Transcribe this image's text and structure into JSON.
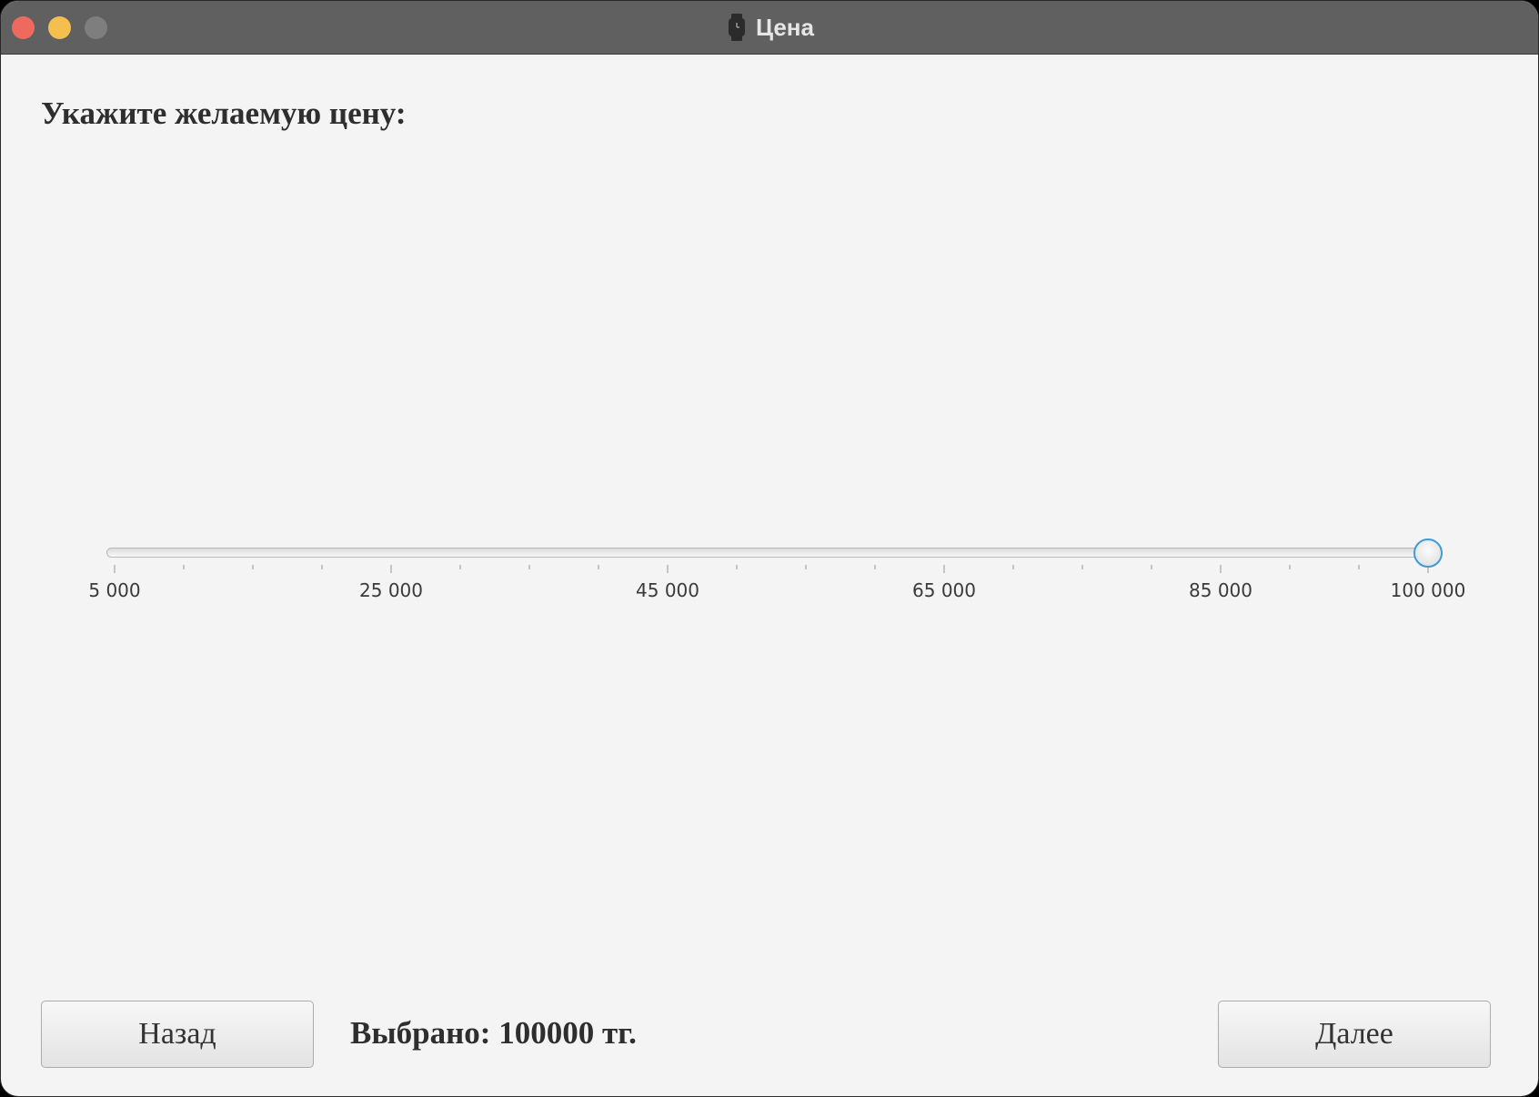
{
  "window": {
    "title": "Цена",
    "title_icon": "watch-icon",
    "traffic_lights": {
      "close": "#ee6a5f",
      "minimize": "#f5bf4f",
      "zoom": "#7e7e7e"
    }
  },
  "main": {
    "prompt": "Укажите желаемую цену:",
    "slider": {
      "min": 5000,
      "max": 100000,
      "value": 100000,
      "major_tick_step": 20000,
      "minor_tick_step": 5000,
      "labels": [
        "5 000",
        "25 000",
        "45 000",
        "65 000",
        "85 000",
        "100 000"
      ],
      "accent": "#3f9bd6"
    },
    "selected_text": "Выбрано: 100000 тг."
  },
  "footer": {
    "back_label": "Назад",
    "next_label": "Далее"
  }
}
